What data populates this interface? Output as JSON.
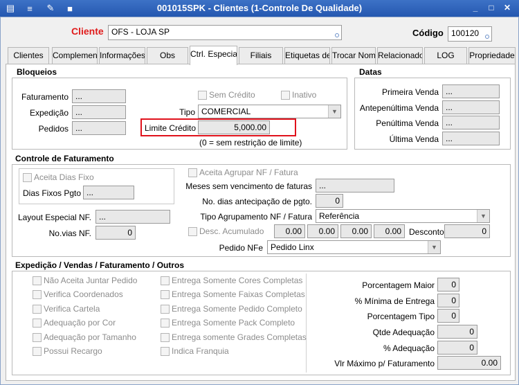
{
  "window": {
    "title": "001015SPK - Clientes (1-Controle De Qualidade)",
    "min": "_",
    "max": "□",
    "close": "✕"
  },
  "header": {
    "cliente_label": "Cliente",
    "cliente_value": "OFS - LOJA SP",
    "codigo_label": "Código",
    "codigo_value": "100120"
  },
  "tabs": [
    "Clientes",
    "Complement",
    "Informações",
    "Obs",
    "Ctrl. Especia",
    "Filiais",
    "Etiquetas de",
    "Trocar Nome",
    "Relacionado",
    "LOG",
    "Propriedade"
  ],
  "bloqueios": {
    "title": "Bloqueios",
    "faturamento_label": "Faturamento",
    "faturamento_value": "...",
    "expedicao_label": "Expedição",
    "expedicao_value": "...",
    "pedidos_label": "Pedidos",
    "pedidos_value": "...",
    "sem_credito": "Sem Crédito",
    "inativo": "Inativo",
    "tipo_label": "Tipo",
    "tipo_value": "COMERCIAL",
    "limite_label": "Limite Crédito",
    "limite_value": "5,000.00",
    "limite_note": "(0 = sem restrição de limite)"
  },
  "datas": {
    "title": "Datas",
    "primeira_label": "Primeira Venda",
    "primeira_value": "...",
    "antepenultima_label": "Antepenúltima Venda",
    "antepenultima_value": "...",
    "penultima_label": "Penúltima Venda",
    "penultima_value": "...",
    "ultima_label": "Última Venda",
    "ultima_value": "..."
  },
  "faturamento": {
    "title": "Controle de Faturamento",
    "aceita_dias_fixo": "Aceita Dias Fixo",
    "dias_fixos_label": "Dias Fixos Pgto",
    "dias_fixos_value": "...",
    "layout_label": "Layout Especial NF.",
    "layout_value": "...",
    "novias_label": "No.vias NF.",
    "novias_value": "0",
    "aceita_agrupar": "Aceita Agrupar NF / Fatura",
    "meses_label": "Meses sem vencimento de faturas",
    "meses_value": "...",
    "antecipacao_label": "No. dias antecipação de pgto.",
    "antecipacao_value": "0",
    "tipo_agrup_label": "Tipo Agrupamento NF / Fatura",
    "tipo_agrup_value": "Referência",
    "desc_acum_label": "Desc. Acumulado",
    "desc_values": [
      "0.00",
      "0.00",
      "0.00",
      "0.00"
    ],
    "desconto_label": "Desconto",
    "desconto_value": "0",
    "pedido_nfe_label": "Pedido NFe",
    "pedido_nfe_value": "Pedido Linx"
  },
  "expedicao": {
    "title": "Expedição / Vendas / Faturamento / Outros",
    "left_checks": [
      "Não Aceita Juntar Pedido",
      "Verifica Coordenados",
      "Verifica Cartela",
      "Adequação por Cor",
      "Adequação por Tamanho",
      "Possui Recargo"
    ],
    "mid_checks": [
      "Entrega Somente Cores Completas",
      "Entrega Somente Faixas Completas",
      "Entrega Somente Pedido Completo",
      "Entrega Somente Pack Completo",
      "Entrega somente Grades Completas",
      "Indica Franquia"
    ],
    "porc_maior_label": "Porcentagem Maior",
    "porc_maior_value": "0",
    "min_entrega_label": "% Mínima de Entrega",
    "min_entrega_value": "0",
    "porc_tipo_label": "Porcentagem Tipo",
    "porc_tipo_value": "0",
    "qtde_adeq_label": "Qtde Adequação",
    "qtde_adeq_value": "0",
    "perc_adeq_label": "% Adequação",
    "perc_adeq_value": "0",
    "vlr_max_label": "Vlr Máximo p/ Faturamento",
    "vlr_max_value": "0.00"
  },
  "colors": {
    "title_bar": "#2f66bd",
    "cliente_label": "#e01b1b",
    "highlight": "#e0111b"
  }
}
